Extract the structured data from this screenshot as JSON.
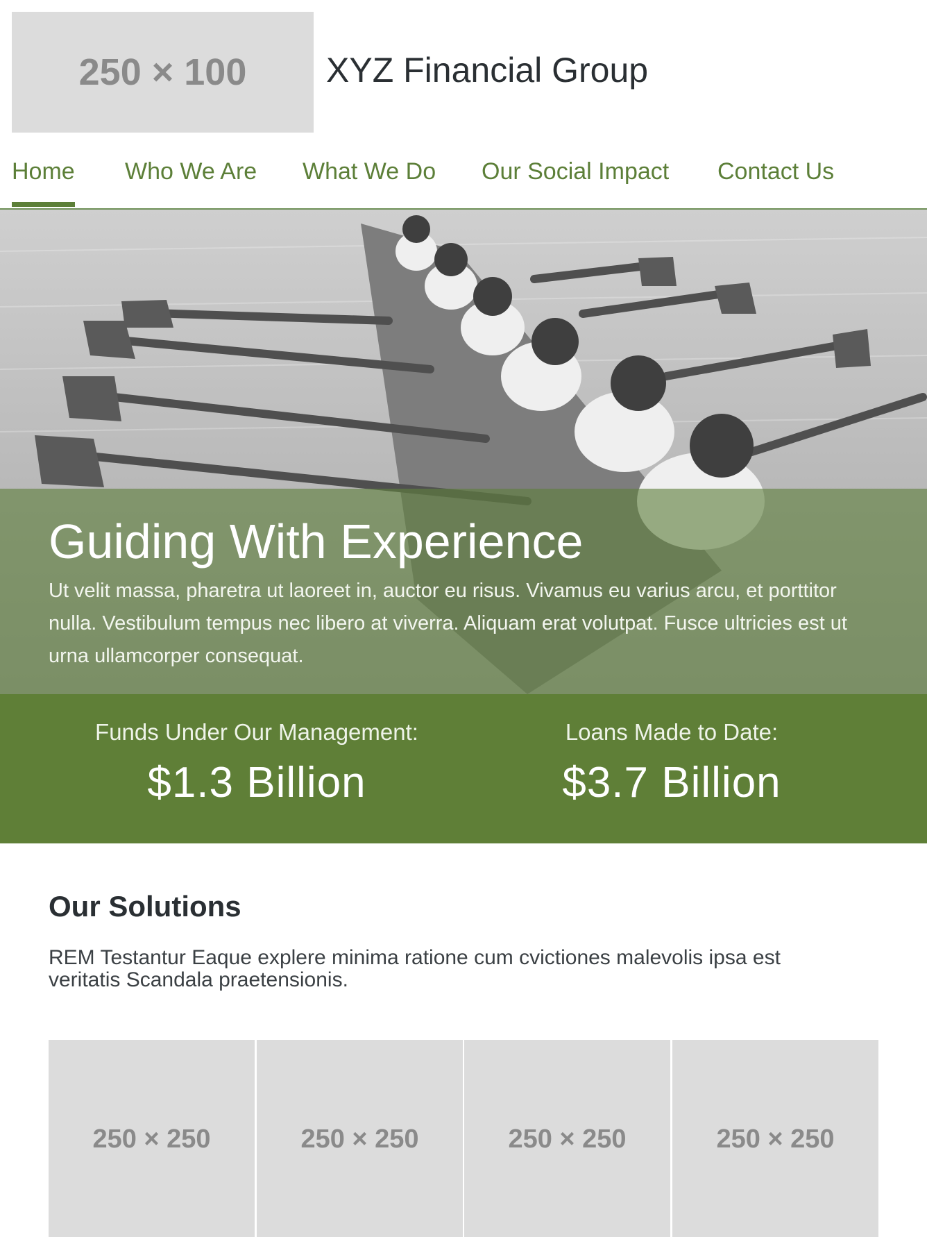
{
  "header": {
    "logo_placeholder": "250 × 100",
    "company_name": "XYZ Financial Group"
  },
  "nav": {
    "items": [
      {
        "label": "Home",
        "active": true
      },
      {
        "label": "Who We Are",
        "active": false
      },
      {
        "label": "What We Do",
        "active": false
      },
      {
        "label": "Our Social Impact",
        "active": false
      },
      {
        "label": "Contact Us",
        "active": false
      }
    ]
  },
  "hero": {
    "title": "Guiding With Experience",
    "text": "Ut velit massa, pharetra ut laoreet in, auctor eu risus. Vivamus eu varius arcu, et porttitor nulla. Vestibulum tempus nec libero at viverra. Aliquam erat volutpat. Fusce ultricies est ut urna ullamcorper consequat."
  },
  "stats": [
    {
      "label": "Funds Under Our Management:",
      "value": "$1.3 Billion"
    },
    {
      "label": "Loans Made to Date:",
      "value": "$3.7 Billion"
    }
  ],
  "solutions": {
    "title": "Our Solutions",
    "text": "REM Testantur Eaque explere minima ratione cum cvictiones malevolis ipsa est veritatis Scandala praetensionis.",
    "tiles": [
      "250 × 250",
      "250 × 250",
      "250 × 250",
      "250 × 250"
    ]
  },
  "colors": {
    "accent_green": "#5f7f37",
    "nav_green": "#5c7f38",
    "placeholder_gray": "#dcdcdc"
  }
}
